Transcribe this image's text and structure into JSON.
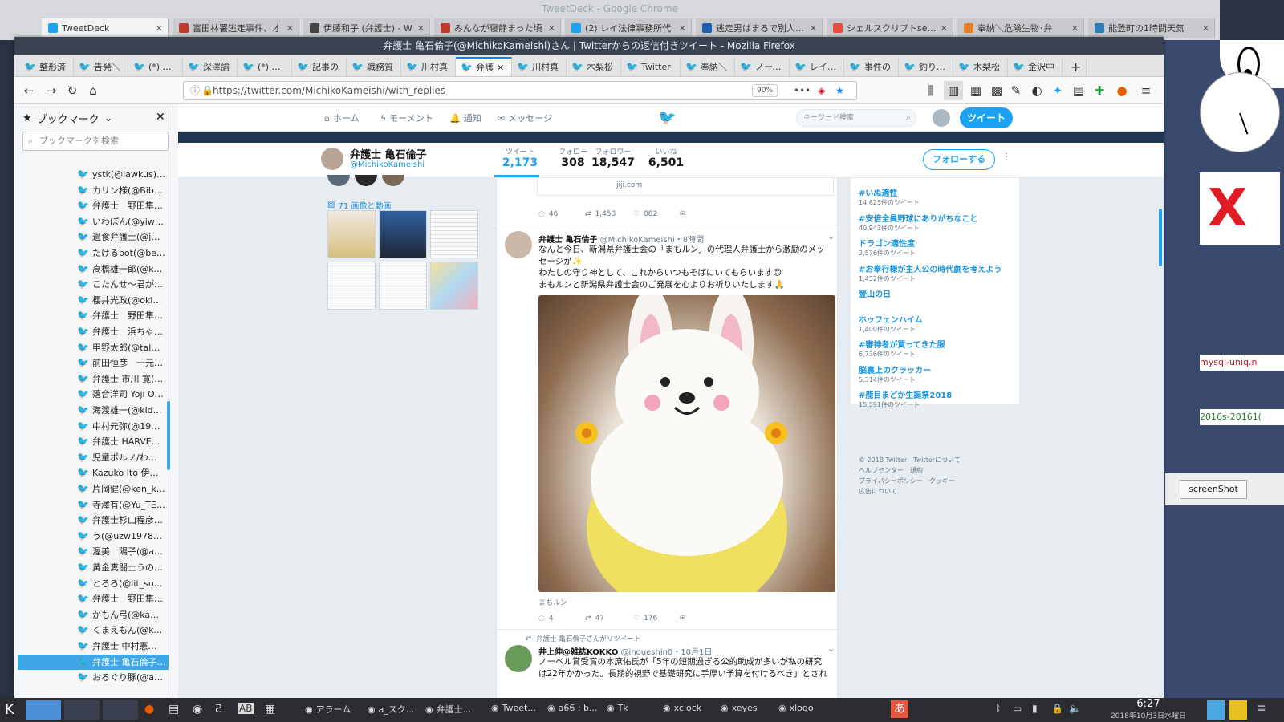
{
  "chrome": {
    "title": "TweetDeck - Google Chrome",
    "tabs": [
      {
        "label": "TweetDeck",
        "color": "#1da1f2"
      },
      {
        "label": "富田林署逃走事件、才",
        "color": "#c0392b"
      },
      {
        "label": "伊藤和子 (弁護士) - W",
        "color": "#444444"
      },
      {
        "label": "みんなが寝静まった頃",
        "color": "#c0392b"
      },
      {
        "label": "(2) レイ法律事務所代",
        "color": "#1da1f2"
      },
      {
        "label": "逃走男はまるで別人…",
        "color": "#1a5fb4"
      },
      {
        "label": "シェルスクリプトselect",
        "color": "#e74c3c"
      },
      {
        "label": "奉納＼危険生物･弁",
        "color": "#e67e22"
      },
      {
        "label": "能登町の1時間天気",
        "color": "#2980b9"
      }
    ]
  },
  "firefox": {
    "title": "弁護士 亀石倫子(@MichikoKameishi)さん | Twitterからの返信付きツイート - Mozilla Firefox",
    "tabs": [
      "整形済",
      "告発＼",
      "(*) 村松",
      "深澤諭",
      "(*) えき",
      "記事の",
      "職務質",
      "川村真",
      "弁護",
      "川村真",
      "木梨松",
      "Twitter",
      "奉納＼",
      "ノースラ",
      "レイ法律",
      "事件の",
      "釣りビシ",
      "木梨松",
      "金沢中"
    ],
    "url": "https://twitter.com/MichikoKameishi/with_replies",
    "zoom": "90%"
  },
  "sidebar": {
    "title": "ブックマーク",
    "search_placeholder": "ブックマークを検索",
    "items": [
      "ystk(@lawkus)さ…",
      "カリン様(@Biben…",
      "弁護士　野田隼…",
      "いわぽん(@yiwa…",
      "過食弁護士(@ju…",
      "たけるbot(@bex…",
      "高橋雄一郎(@ka…",
      "こたんせ〜君が…",
      "櫻井光政(@okin…",
      "弁護士　野田隼…",
      "弁護士　浜ちゃ…",
      "甲野太郎(@talo_…",
      "前田恒彦　一元…",
      "弁護士 市川 寛(…",
      "落合洋司 Yoji Oc…",
      "海渡雄一(@kidk…",
      "中村元弥(@196…",
      "弁護士 HARVEY(…",
      "児童ポルノ/わい…",
      "Kazuko Ito 伊藤…",
      "片岡健(@ken_ka…",
      "寺澤有(@Yu_TE…",
      "弁護士杉山程彦…",
      "う(@uzw1978)さ…",
      "渥美　陽子(@at…",
      "黄金糞闘士うの…",
      "とろろ(@lit_soc)…",
      "弁護士　野田隼…",
      "かもん弓(@kam…",
      "くまえもん(@kum…",
      "弁護士 中村憲昭(…",
      "弁護士 亀石倫子(…",
      "おるぐり豚(@allg…"
    ],
    "selected_index": 31
  },
  "twitter": {
    "nav": {
      "home": "ホーム",
      "moments": "モーメント",
      "notifications": "通知",
      "messages": "メッセージ",
      "search_placeholder": "キーワード検索",
      "tweet": "ツイート"
    },
    "profile": {
      "name": "弁護士 亀石倫子",
      "handle": "@MichikoKameishi",
      "stats": [
        {
          "label": "ツイート",
          "value": "2,173"
        },
        {
          "label": "フォロー",
          "value": "308"
        },
        {
          "label": "フォロワー",
          "value": "18,547"
        },
        {
          "label": "いいね",
          "value": "6,501"
        }
      ],
      "follow": "フォローする",
      "media_link": "71 画像と動画"
    },
    "tweets": [
      {
        "link_domain": "jiji.com",
        "replies": "46",
        "retweets": "1,453",
        "likes": "882"
      },
      {
        "name": "弁護士 亀石倫子",
        "handle": "@MichikoKameishi",
        "time": "・8時間",
        "line1": "なんと今日、新潟県弁護士会の「まもルン」の代理人弁護士から激励のメッ",
        "line2": "セージが✨",
        "line3": "わたしの守り神として、これからいつもそばにいてもらいます😊",
        "line4": "まもルンと新潟県弁護士会のご発展を心よりお祈りいたします🙏",
        "caption": "まもルン",
        "replies": "4",
        "retweets": "47",
        "likes": "176"
      },
      {
        "retweet_note": "弁護士 亀石倫子さんがリツイート",
        "name": "井上伸@雑誌KOKKO",
        "handle": "@inoueshin0",
        "time": "・10月1日",
        "line1": "ノーベル賞受賞の本庶佑氏が「5年の短期過ぎる公的助成が多いが私の研究",
        "line2": "は22年かかった。長期的視野で基礎研究に手厚い予算を付けるべき」とされ"
      }
    ],
    "trends": [
      {
        "tag": "#いぬ適性",
        "count": "14,625件のツイート"
      },
      {
        "tag": "#安倍全員野球にありがちなこと",
        "count": "40,943件のツイート"
      },
      {
        "tag": "ドラゴン適性度",
        "count": "2,576件のツイート"
      },
      {
        "tag": "#お奉行様が主人公の時代劇を考えよう",
        "count": "1,452件のツイート"
      },
      {
        "tag": "登山の日",
        "count": ""
      },
      {
        "tag": "ホッフェンハイム",
        "count": "1,400件のツイート"
      },
      {
        "tag": "#審神者が買ってきた服",
        "count": "6,736件のツイート"
      },
      {
        "tag": "脳裏上のクラッカー",
        "count": "5,314件のツイート"
      },
      {
        "tag": "#鹿目まどか生誕祭2018",
        "count": "15,591件のツイート"
      }
    ],
    "footer": {
      "line1": "© 2018 Twitter　Twitterについて",
      "line2": "ヘルプセンター　規約",
      "line3": "プライバシーポリシー　クッキー",
      "line4": "広告について"
    }
  },
  "desktop": {
    "screenshot_label": "screenShot",
    "mysql_label": "mysql-uniq.n",
    "date_label": "2016s-20161(",
    "taskbar": {
      "items": [
        "アラーム",
        "a_スク...",
        "弁護士...",
        "Tweet...",
        "a66 : b...",
        "Tk",
        "xclock",
        "xeyes",
        "xlogo"
      ],
      "time": "6:27",
      "date": "2018年10月3日水曜日"
    }
  },
  "colors": {
    "twitter_blue": "#1da1f2",
    "link_blue": "#1b95e0",
    "selected_bm": "#3da7e8"
  }
}
